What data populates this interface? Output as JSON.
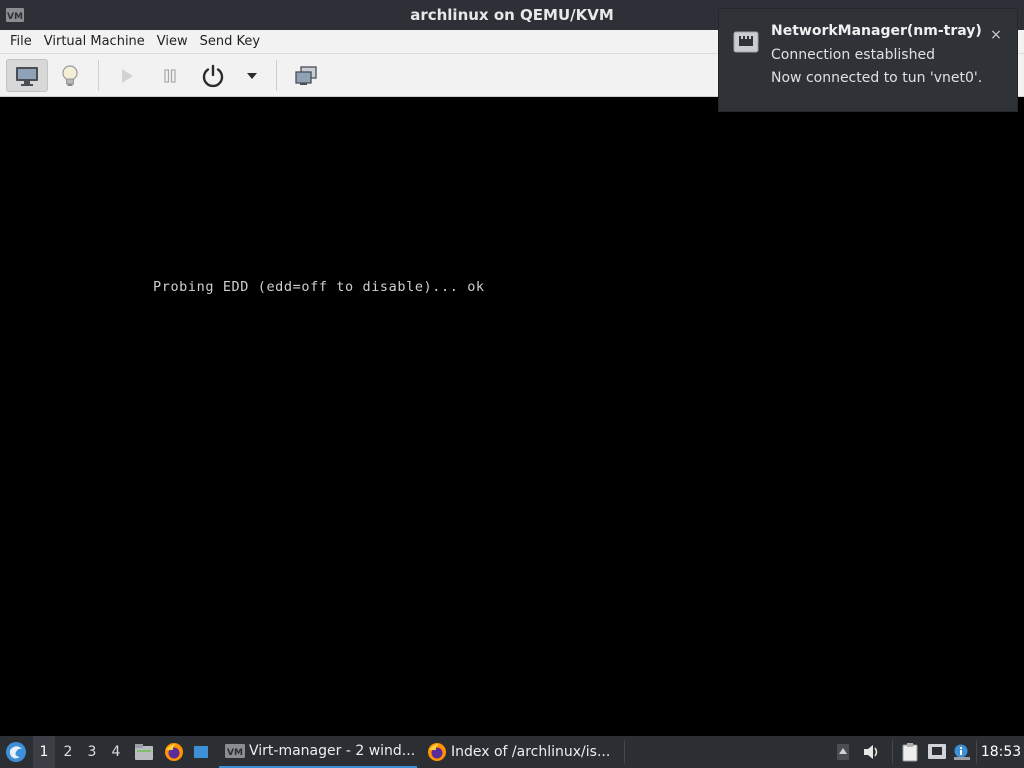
{
  "window": {
    "title": "archlinux on QEMU/KVM",
    "app_icon": "virt-manager-icon"
  },
  "menubar": {
    "items": [
      "File",
      "Virtual Machine",
      "View",
      "Send Key"
    ]
  },
  "toolbar": {
    "buttons": [
      {
        "name": "console-view-button",
        "icon": "monitor-icon",
        "active": true
      },
      {
        "name": "details-view-button",
        "icon": "lightbulb-icon",
        "active": false
      },
      {
        "name": "run-button",
        "icon": "play-icon",
        "enabled": false
      },
      {
        "name": "pause-button",
        "icon": "pause-icon",
        "enabled": false
      },
      {
        "name": "shutdown-button",
        "icon": "power-icon",
        "enabled": true
      },
      {
        "name": "shutdown-menu-button",
        "icon": "chevron-down-icon",
        "enabled": true
      },
      {
        "name": "fullscreen-button",
        "icon": "fullscreen-icon",
        "enabled": true
      }
    ]
  },
  "console": {
    "text": "Probing EDD (edd=off to disable)... ok"
  },
  "notification": {
    "title": "NetworkManager(nm-tray)",
    "line1": "Connection established",
    "line2": "Now connected to tun 'vnet0'.",
    "close": "×",
    "icon": "network-wired-icon"
  },
  "taskbar": {
    "workspaces": [
      "1",
      "2",
      "3",
      "4"
    ],
    "active_workspace": "1",
    "tasks": [
      {
        "label": "Virt-manager - 2 wind...",
        "icon": "virt-manager-icon",
        "active": true
      },
      {
        "label": "Index of /archlinux/is...",
        "icon": "firefox-icon",
        "active": false
      }
    ],
    "clock": "18:53"
  },
  "colors": {
    "titlebar": "#2d3036",
    "taskbar": "#2b2e33",
    "accent": "#3d8fd6"
  }
}
